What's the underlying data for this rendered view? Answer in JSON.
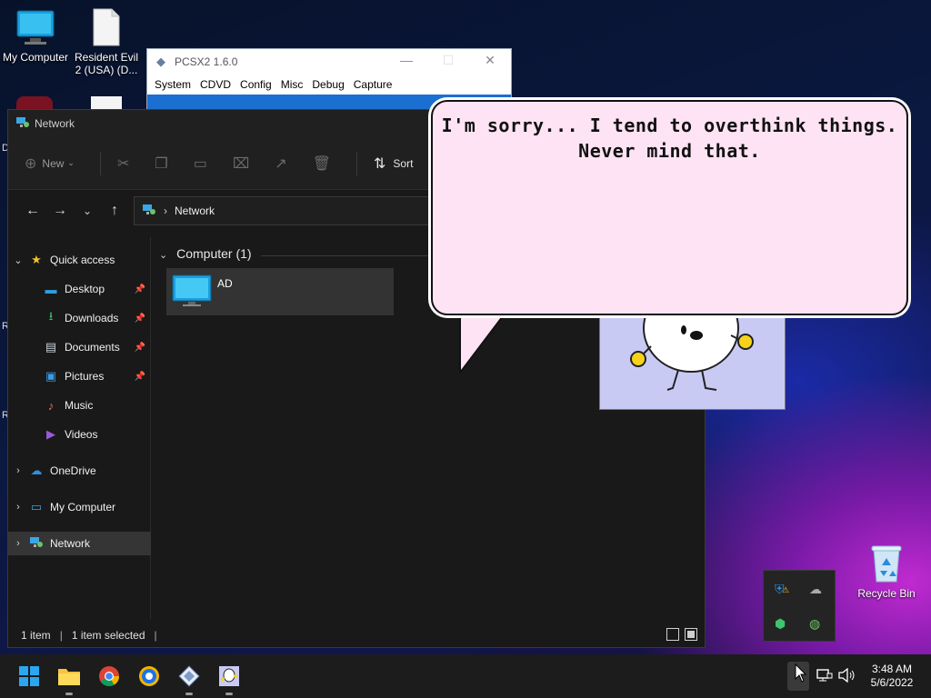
{
  "desktop": {
    "icons": [
      {
        "label": "My Computer",
        "icon": "monitor-icon"
      },
      {
        "label": "Resident Evil 2 (USA) (D...",
        "icon": "file-icon"
      },
      {
        "label": "Recycle Bin",
        "icon": "recycle-bin-icon"
      }
    ],
    "edge_letters": [
      "D",
      "R",
      "R"
    ]
  },
  "pcsx2": {
    "title": "PCSX2  1.6.0",
    "menu": [
      "System",
      "CDVD",
      "Config",
      "Misc",
      "Debug",
      "Capture"
    ],
    "colors": {
      "client": "#1b6fd0"
    }
  },
  "explorer": {
    "title": "Network",
    "commands": {
      "new_label": "New",
      "sort_label": "Sort"
    },
    "address": {
      "location": "Network"
    },
    "nav": {
      "quick_access": "Quick access",
      "desktop": "Desktop",
      "downloads": "Downloads",
      "documents": "Documents",
      "pictures": "Pictures",
      "music": "Music",
      "videos": "Videos",
      "onedrive": "OneDrive",
      "my_computer": "My Computer",
      "network": "Network"
    },
    "group": {
      "header": "Computer (1)"
    },
    "items": [
      {
        "label": "AD",
        "icon": "computer-icon"
      }
    ],
    "status": {
      "count": "1 item",
      "selected": "1 item selected"
    }
  },
  "speech_bubble": {
    "line1": "I'm sorry... I tend to overthink things.",
    "line2": "Never mind that."
  },
  "taskbar": {
    "apps": [
      "start-icon",
      "file-explorer-icon",
      "chrome-icon",
      "browser-icon",
      "pcsx2-icon",
      "character-app-icon"
    ],
    "clock_time": "3:48 AM",
    "clock_date": "5/6/2022"
  },
  "colors": {
    "accent": "#0078d4",
    "bubble": "#fde3f3",
    "char_bg": "#c9caf4"
  }
}
